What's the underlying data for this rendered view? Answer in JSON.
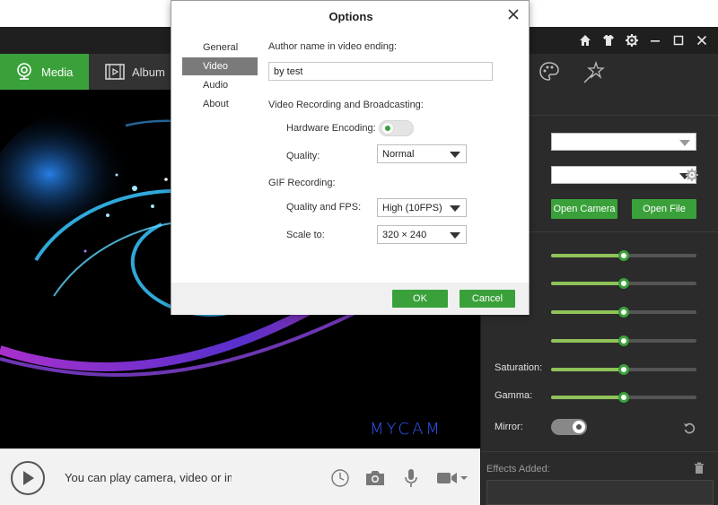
{
  "app": {
    "tabs": [
      {
        "label": "Media"
      },
      {
        "label": "Album"
      }
    ],
    "preview_logo": "MYCAM",
    "bottom_hint": "You can play camera, video or image"
  },
  "side_panel": {
    "buttons": {
      "open_camera": "Open Camera",
      "open_file": "Open File"
    },
    "sliders": [
      {
        "label": "",
        "value": 0.5
      },
      {
        "label": "",
        "value": 0.5
      },
      {
        "label": "",
        "value": 0.5
      },
      {
        "label": "",
        "value": 0.5
      },
      {
        "label": "Saturation:",
        "value": 0.5
      },
      {
        "label": "Gamma:",
        "value": 0.5
      }
    ],
    "mirror_label": "Mirror:",
    "effects_label": "Effects Added:"
  },
  "dialog": {
    "title": "Options",
    "nav": [
      {
        "label": "General",
        "active": false
      },
      {
        "label": "Video",
        "active": true
      },
      {
        "label": "Audio",
        "active": false
      },
      {
        "label": "About",
        "active": false
      }
    ],
    "author_label": "Author name in video ending:",
    "author_value": "by test",
    "recording_section": "Video Recording and Broadcasting:",
    "hw_encoding_label": "Hardware Encoding:",
    "quality_label": "Quality:",
    "quality_value": "Normal",
    "gif_section": "GIF Recording:",
    "gif_quality_label": "Quality and FPS:",
    "gif_quality_value": "High (10FPS)",
    "scale_label": "Scale to:",
    "scale_value": "320 × 240",
    "ok_label": "OK",
    "cancel_label": "Cancel"
  },
  "colors": {
    "accent": "#3aa13a",
    "panel": "#2b2b2b",
    "slider_fill": "#8fc35a",
    "logo": "#3355ff"
  }
}
